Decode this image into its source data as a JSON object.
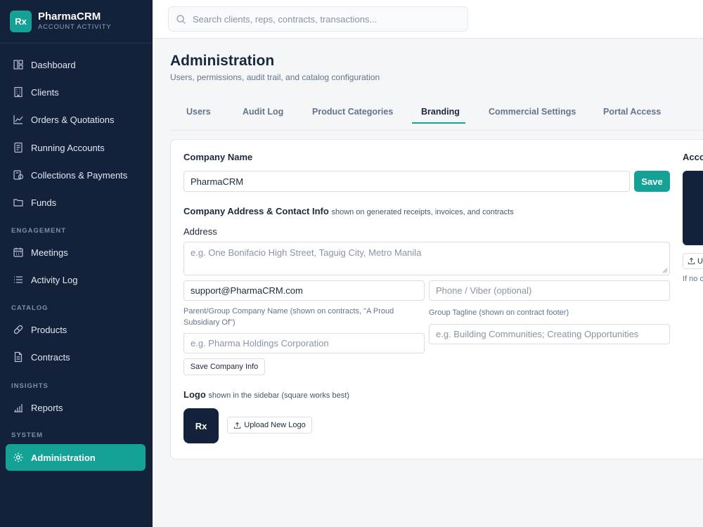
{
  "brand": {
    "logo": "Rx",
    "name": "PharmaCRM",
    "subtitle": "ACCOUNT ACTIVITY"
  },
  "sidebar": {
    "items": [
      {
        "label": "Dashboard",
        "icon": "dashboard-icon"
      },
      {
        "label": "Clients",
        "icon": "building-icon"
      },
      {
        "label": "Orders & Quotations",
        "icon": "chart-line-icon"
      },
      {
        "label": "Running Accounts",
        "icon": "ledger-icon"
      },
      {
        "label": "Collections & Payments",
        "icon": "payments-icon"
      },
      {
        "label": "Funds",
        "icon": "folder-icon"
      },
      {
        "label": "Meetings",
        "icon": "calendar-icon"
      },
      {
        "label": "Activity Log",
        "icon": "list-icon"
      },
      {
        "label": "Products",
        "icon": "pill-icon"
      },
      {
        "label": "Contracts",
        "icon": "document-icon"
      },
      {
        "label": "Reports",
        "icon": "bar-chart-icon"
      },
      {
        "label": "Administration",
        "icon": "gear-icon",
        "active": true
      }
    ],
    "sections": [
      "ENGAGEMENT",
      "CATALOG",
      "INSIGHTS",
      "SYSTEM"
    ]
  },
  "search": {
    "placeholder": "Search clients, reps, contracts, transactions..."
  },
  "page": {
    "title": "Administration",
    "subtitle": "Users, permissions, audit trail, and catalog configuration"
  },
  "tabs": [
    "Users",
    "Audit Log",
    "Product Categories",
    "Branding",
    "Commercial Settings",
    "Portal Access"
  ],
  "active_tab": "Branding",
  "accent_color": "#14a196",
  "sidebar_color": "#14213b",
  "branding": {
    "company_name_label": "Company Name",
    "company_name_value": "PharmaCRM",
    "save_label": "Save",
    "contact_heading": "Company Address & Contact Info",
    "contact_note": "shown on generated receipts, invoices, and contracts",
    "address_label": "Address",
    "address_placeholder": "e.g. One Bonifacio High Street, Taguig City, Metro Manila",
    "email_value": "support@PharmaCRM.com",
    "phone_placeholder": "Phone / Viber (optional)",
    "parent_label": "Parent/Group Company Name (shown on contracts, \"A Proud Subsidiary Of\")",
    "parent_placeholder": "e.g. Pharma Holdings Corporation",
    "tagline_label": "Group Tagline (shown on contract footer)",
    "tagline_placeholder": "e.g. Building Communities; Creating Opportunities",
    "save_info_label": "Save Company Info",
    "logo_heading": "Logo",
    "logo_note": "shown in the sidebar (square works best)",
    "logo_text": "Rx",
    "upload_logo_label": "Upload New Logo"
  },
  "right_panel": {
    "title_partial": "Acco",
    "button_partial": "U",
    "note_partial": "If no c"
  }
}
